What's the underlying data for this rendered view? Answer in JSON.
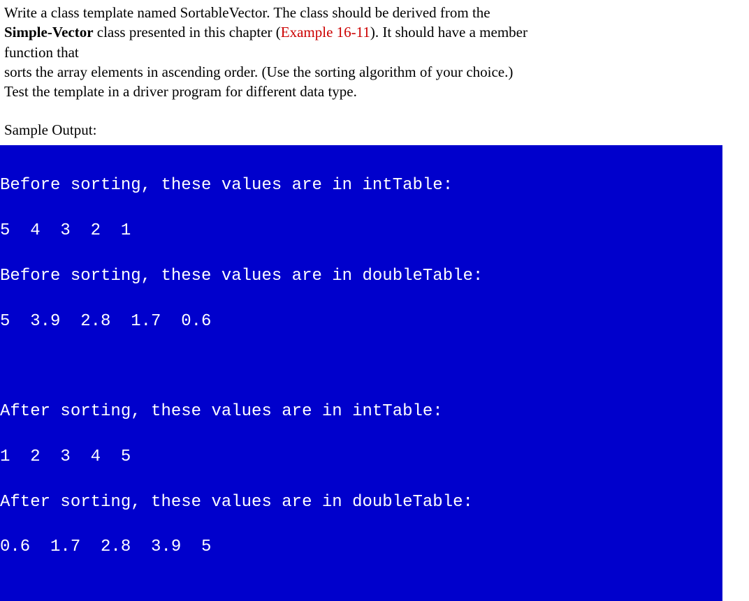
{
  "instructions": {
    "line1_a": "Write a class template named SortableVector. The class should be derived from the",
    "line2_bold": "Simple-Vector",
    "line2_rest": " class presented in this chapter (",
    "line2_red": "Example 16-11",
    "line2_end": "). It should have a member",
    "line3": "function that",
    "line4": "sorts the array elements in ascending order. (Use the sorting algorithm of your choice.)",
    "line5": "Test the template in a driver program for different data type."
  },
  "sample_output_label": "Sample Output:",
  "console": {
    "lines": [
      "Before sorting, these values are in intTable:",
      "5  4  3  2  1",
      "Before sorting, these values are in doubleTable:",
      "5  3.9  2.8  1.7  0.6",
      "",
      "After sorting, these values are in intTable:",
      "1  2  3  4  5",
      "After sorting, these values are in doubleTable:",
      "0.6  1.7  2.8  3.9  5"
    ]
  }
}
